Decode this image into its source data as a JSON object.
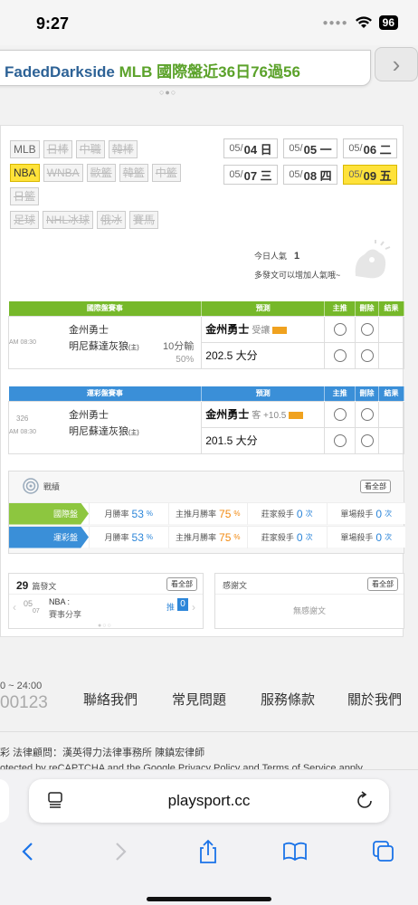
{
  "status": {
    "time": "9:27",
    "battery": "96"
  },
  "banner": {
    "name": "FadedDarkside",
    "subtitle": "MLB 國際盤近36日76過56"
  },
  "categories": {
    "row1": [
      "MLB",
      "日棒",
      "中職",
      "韓棒"
    ],
    "row2": [
      "NBA",
      "WNBA",
      "歐籃",
      "韓籃",
      "中籃"
    ],
    "row3": [
      "日籃"
    ],
    "row4": [
      "足球",
      "NHL冰球",
      "俄冰",
      "賽馬"
    ]
  },
  "dates": [
    {
      "md": "05/",
      "d": "04 日"
    },
    {
      "md": "05/",
      "d": "05 一"
    },
    {
      "md": "05/",
      "d": "06 二"
    },
    {
      "md": "05/",
      "d": "07 三"
    },
    {
      "md": "05/",
      "d": "08 四"
    },
    {
      "md": "05/",
      "d": "09 五"
    }
  ],
  "popularity": {
    "label": "今日人氣",
    "value": "1",
    "hint": "多發文可以增加人氣哦~"
  },
  "intl_table": {
    "headers": [
      "國際盤賽事",
      "預測",
      "主推",
      "刪除",
      "結果"
    ],
    "time": "AM 08:30",
    "team1": "金州勇士",
    "team2": "明尼蘇達灰狼",
    "team2_suffix": "(主)",
    "extra1": "10分輸",
    "extra2": "50%",
    "pick1": "金州勇士",
    "pick1_sub": "受讓",
    "pick2": "202.5 大分"
  },
  "sport_table": {
    "headers": [
      "運彩盤賽事",
      "預測",
      "主推",
      "刪除",
      "結果"
    ],
    "num": "326",
    "time": "AM 08:30",
    "team1": "金州勇士",
    "team2": "明尼蘇達灰狼",
    "team2_suffix": "(主)",
    "pick1": "金州勇士",
    "pick1_sub": "客 +10.5",
    "pick2": "201.5 大分"
  },
  "stats": {
    "title": "戰績",
    "view_all": "看全部",
    "rows": [
      {
        "label": "國際盤",
        "color": "#8dc63f",
        "month_label": "月勝率",
        "month": "53",
        "main_label": "主推月勝率",
        "main": "75",
        "pct": "%",
        "killer_label": "莊家殺手",
        "killer": "0",
        "single_label": "單場殺手",
        "single": "0",
        "times": "次"
      },
      {
        "label": "運彩盤",
        "color": "#3a8fd8",
        "month_label": "月勝率",
        "month": "53",
        "main_label": "主推月勝率",
        "main": "75",
        "pct": "%",
        "killer_label": "莊家殺手",
        "killer": "0",
        "single_label": "單場殺手",
        "single": "0",
        "times": "次"
      }
    ]
  },
  "posts": {
    "count": "29",
    "label": "篇發文",
    "view_all": "看全部",
    "item_date_md": "05",
    "item_date_d": "07",
    "item_cat": "NBA :",
    "item_title": "賽事分享",
    "push_label": "推",
    "push_count": "0"
  },
  "thanks": {
    "title": "感謝文",
    "view_all": "看全部",
    "empty": "無感謝文"
  },
  "footer": {
    "hours": "0 ~ 24:00",
    "phone_tail": "00123",
    "links": [
      "聯絡我們",
      "常見問題",
      "服務條款",
      "關於我們"
    ],
    "legal": "彩 法律顧問：漢英得力法律事務所 陳鎮宏律師",
    "recaptcha": "otected by reCAPTCHA and the Google Privacy Policy and Terms of Service apply."
  },
  "browser": {
    "url": "playsport.cc"
  }
}
